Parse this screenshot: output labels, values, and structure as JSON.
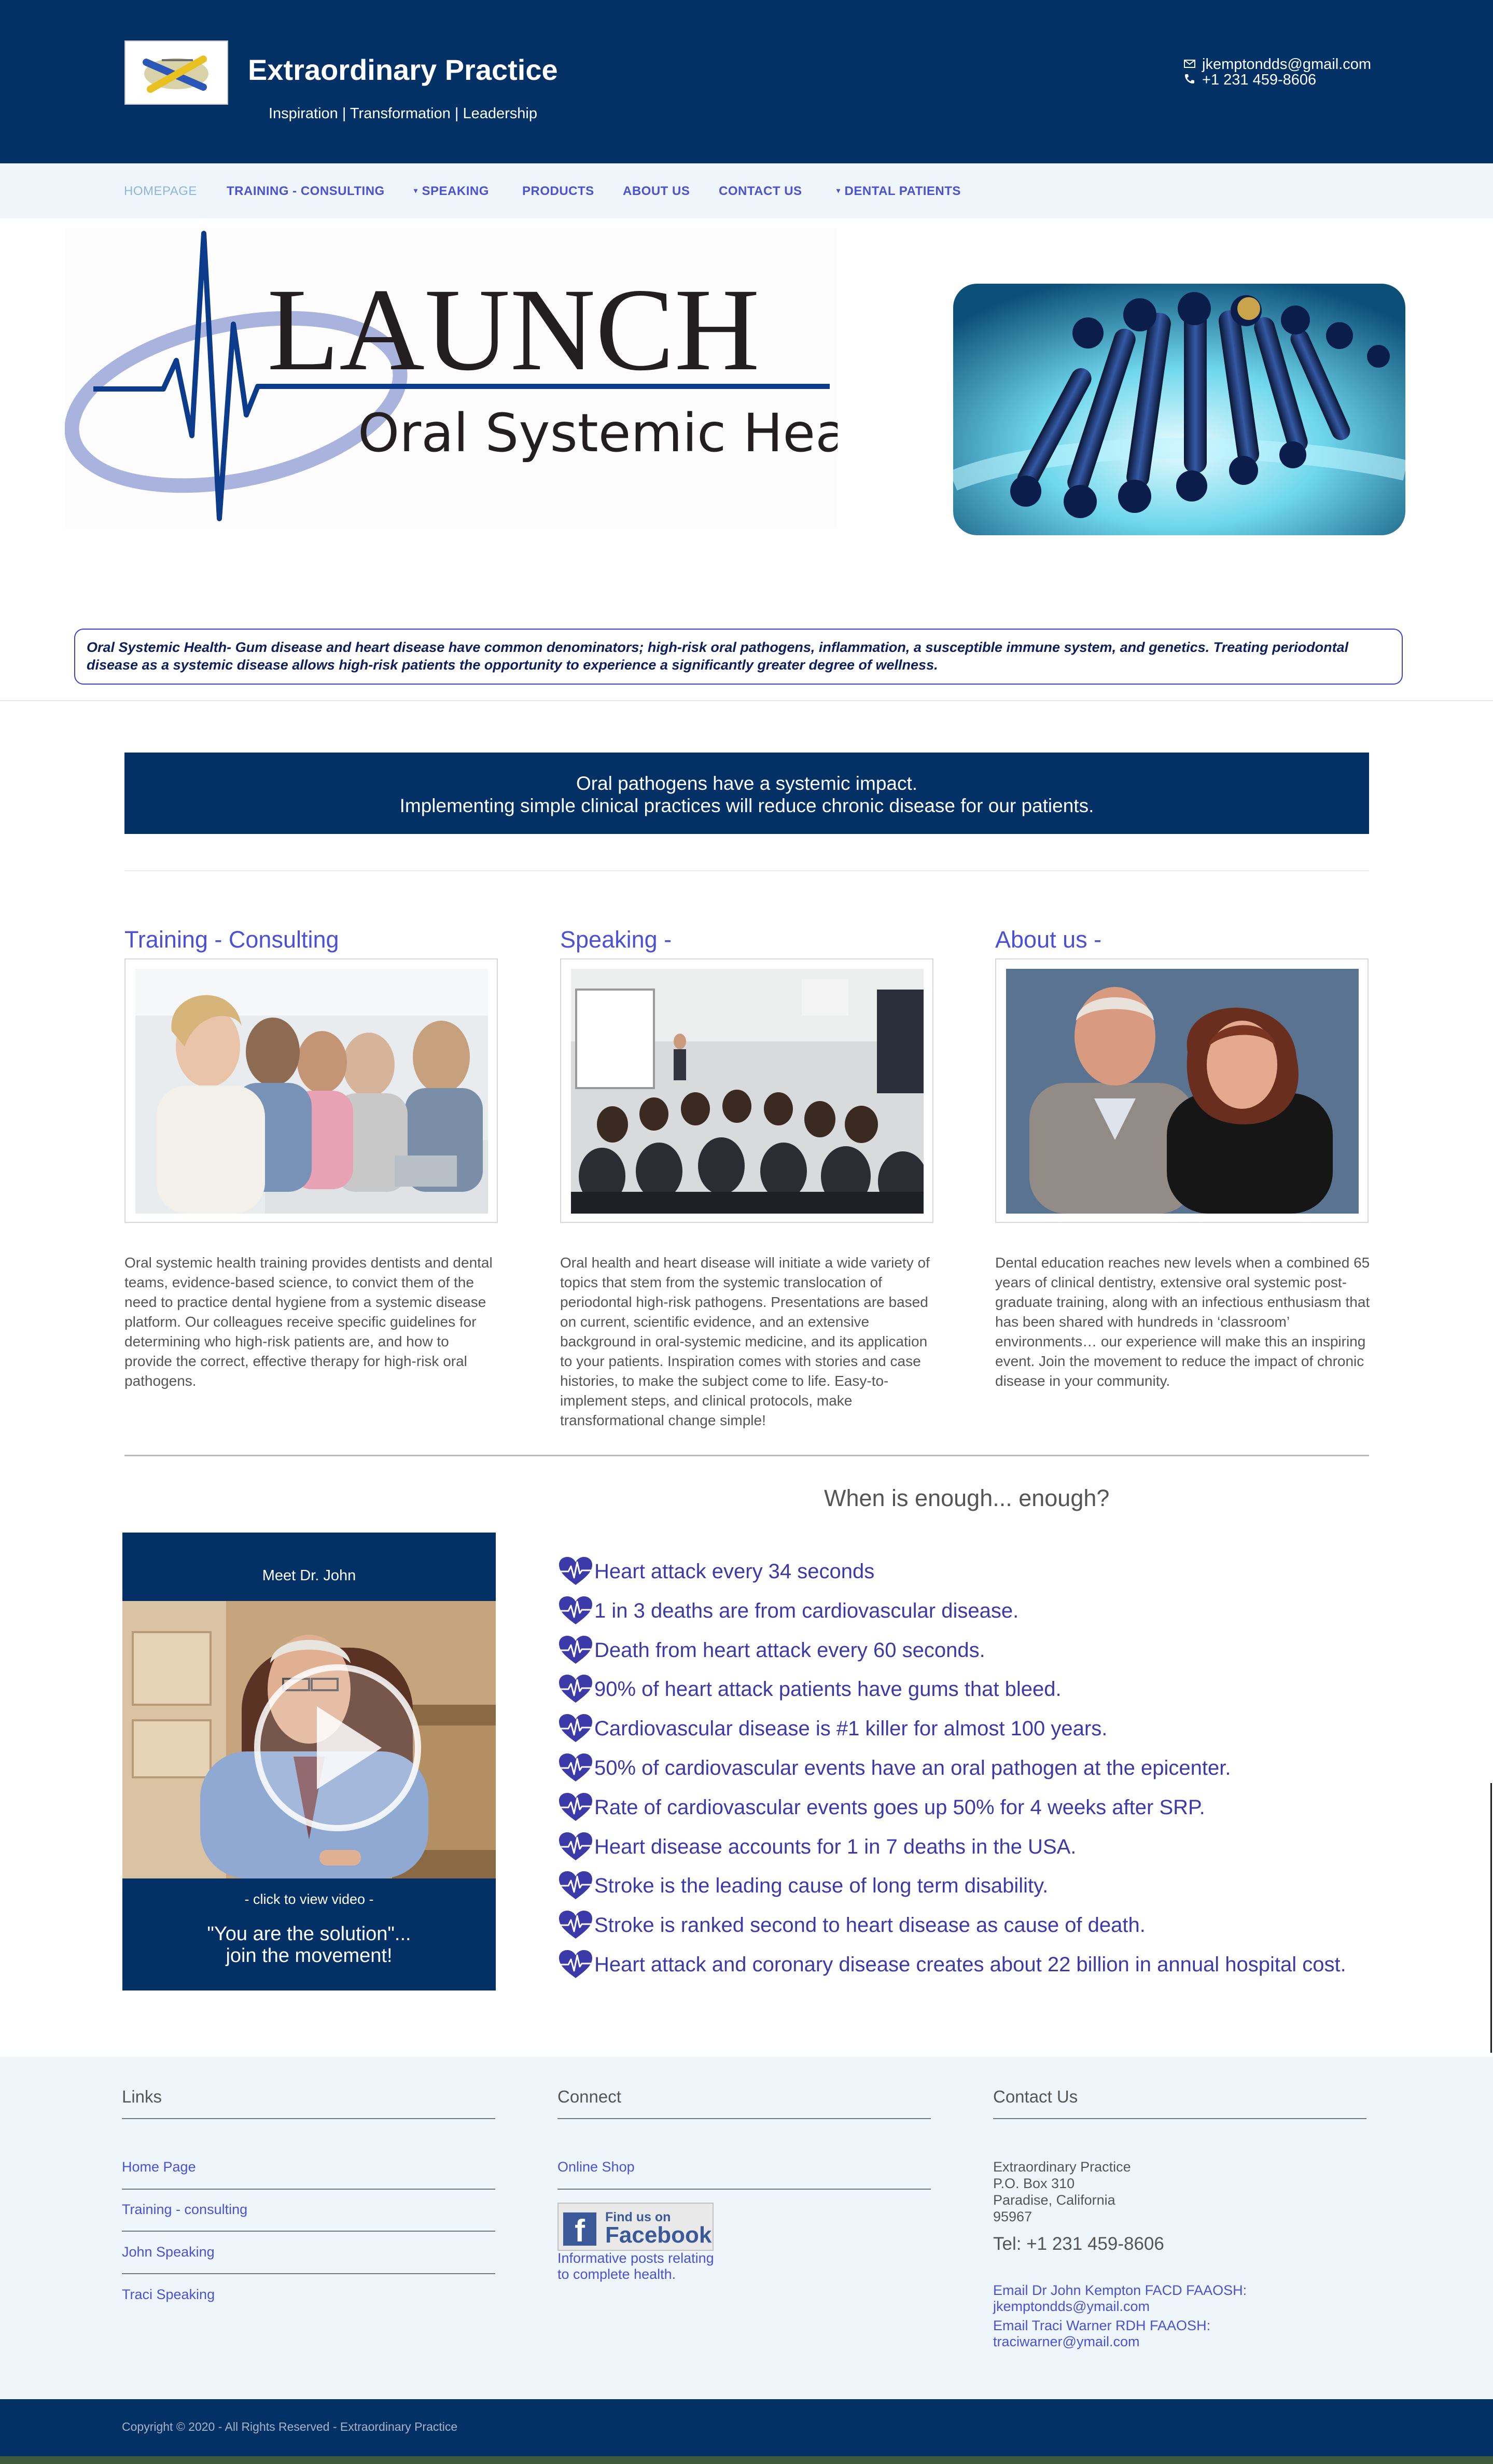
{
  "header": {
    "title": "Extraordinary Practice",
    "tagline": "Inspiration | Transformation | Leadership",
    "email": "jkemptondds@gmail.com",
    "phone": "+1 231 459-8606"
  },
  "nav": {
    "items": [
      {
        "label": "HOMEPAGE",
        "active": true
      },
      {
        "label": "TRAINING - CONSULTING"
      },
      {
        "label": "SPEAKING",
        "dropdown": true
      },
      {
        "label": "PRODUCTS"
      },
      {
        "label": "ABOUT US"
      },
      {
        "label": "CONTACT US"
      },
      {
        "label": "DENTAL PATIENTS",
        "dropdown": true
      }
    ]
  },
  "banner": {
    "logo_word": "LAUNCH",
    "logo_sub": "Oral Systemic Health",
    "statement": "Oral Systemic Health- Gum disease and heart disease have common denominators; high-risk oral pathogens, inflammation, a susceptible immune system, and genetics. Treating periodontal disease as a systemic disease allows high-risk patients the opportunity to experience a significantly greater degree of wellness."
  },
  "impact": {
    "line1": "Oral pathogens have a systemic impact.",
    "line2": "Implementing simple clinical practices will reduce chronic disease for our patients."
  },
  "columns": [
    {
      "title": "Training - Consulting",
      "text": "Oral systemic health training provides dentists and dental teams, evidence-based science, to convict them of the need to practice dental hygiene from a systemic disease platform. Our colleagues receive specific guidelines for determining who high-risk patients are, and how to provide the correct, effective therapy for high-risk oral pathogens."
    },
    {
      "title": "Speaking -",
      "text": "Oral health and heart disease will initiate a wide variety of topics that stem from the systemic translocation of periodontal high-risk pathogens. Presentations are based on current, scientific evidence, and an extensive background in oral-systemic medicine, and its application to your patients. Inspiration comes with stories and case histories, to make the subject come to life. Easy-to-implement steps, and clinical protocols, make transformational change simple!"
    },
    {
      "title": "About us -",
      "text": "Dental education reaches new levels when a combined 65 years of clinical dentistry, extensive oral systemic post-graduate training, along with an infectious enthusiasm that has been shared with hundreds in ‘classroom’ environments… our experience will make this an inspiring event. Join the movement to reduce the impact of chronic disease in your community."
    }
  ],
  "video": {
    "title": "Meet Dr. John",
    "click": "- click to view video -",
    "quote1": "\"You are the solution\"...",
    "quote2": "join the movement!"
  },
  "stats": {
    "heading": "When is enough... enough?",
    "items": [
      "Heart attack every 34 seconds",
      "1 in 3 deaths are from cardiovascular disease.",
      "Death from heart attack every 60 seconds.",
      "90% of heart attack patients have gums that bleed.",
      "Cardiovascular disease is #1 killer for almost 100 years.",
      "50% of cardiovascular events have an oral pathogen at the epicenter.",
      "Rate of cardiovascular events goes up 50% for 4 weeks after SRP.",
      "Heart disease accounts for 1 in 7 deaths in the USA.",
      "Stroke is the leading cause of long term disability.",
      "Stroke is ranked second to heart disease as cause of death.",
      "Heart attack and coronary disease creates about 22 billion in annual hospital cost."
    ]
  },
  "footer": {
    "links_heading": "Links",
    "links": [
      "Home Page",
      "Training - consulting",
      "John Speaking",
      "Traci Speaking"
    ],
    "connect_heading": "Connect",
    "online_shop": "Online Shop",
    "fb_find": "Find us on",
    "fb_name": "Facebook",
    "fb_caption1": "Informative posts relating",
    "fb_caption2": "to complete health.",
    "contact_heading": "Contact Us",
    "address": [
      "Extraordinary Practice",
      "P.O. Box 310",
      "Paradise, California",
      "95967"
    ],
    "tel": "Tel: +1 231 459-8606",
    "email1_label": "Email Dr John Kempton FACD FAAOSH:",
    "email1": "jkemptondds@ymail.com",
    "email2_label": "Email Traci Warner RDH FAAOSH:",
    "email2": "traciwarner@ymail.com"
  },
  "copyright": "Copyright © 2020 - All Rights Reserved - Extraordinary Practice"
}
